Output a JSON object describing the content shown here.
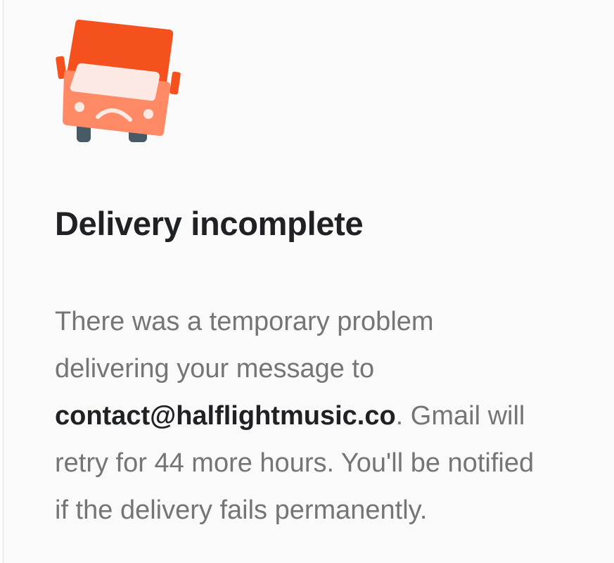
{
  "notice": {
    "icon": "sad-delivery-truck-icon",
    "colors": {
      "truck_top": "#f4511e",
      "truck_body": "#ff8a65",
      "windshield": "#fde9e3",
      "wheels": "#455a64"
    },
    "title": "Delivery incomplete",
    "message": {
      "line1": "There was a temporary problem",
      "line2": "delivering your message to",
      "recipient": "contact@halflightmusic.co",
      "after_recipient": ". Gmail will",
      "line4": "retry for 44 more hours. You'll be notified",
      "line5": "if the delivery fails permanently."
    }
  }
}
